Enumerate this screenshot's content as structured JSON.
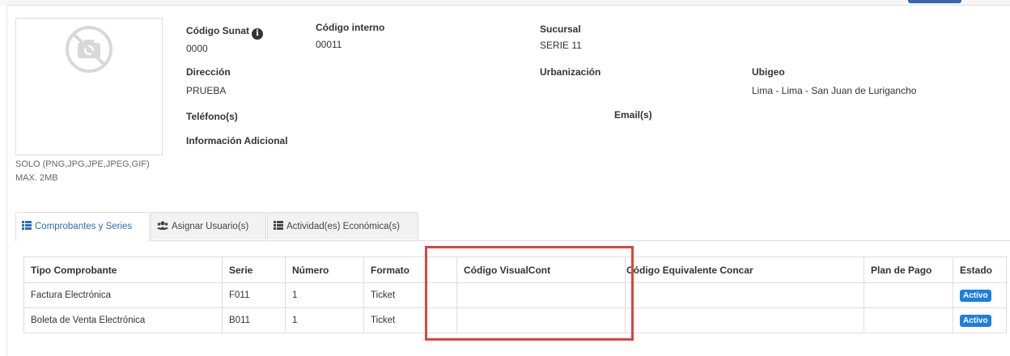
{
  "header": {
    "codigo_sunat_label": "Código Sunat",
    "codigo_sunat_value": "0000",
    "codigo_interno_label": "Código interno",
    "codigo_interno_value": "00011",
    "sucursal_label": "Sucursal",
    "sucursal_value": "SERIE 11",
    "direccion_label": "Dirección",
    "direccion_value": "PRUEBA",
    "urbanizacion_label": "Urbanización",
    "ubigeo_label": "Ubigeo",
    "ubigeo_value": "Lima - Lima - San Juan de Lurigancho",
    "telefono_label": "Teléfono(s)",
    "email_label": "Email(s)",
    "info_adicional_label": "Información Adicional"
  },
  "photo": {
    "note_line1": "SOLO (PNG,JPG,JPE,JPEG,GIF)",
    "note_line2": "MAX. 2MB"
  },
  "tabs": [
    {
      "label": "Comprobantes y Series",
      "icon": "list-icon",
      "active": true
    },
    {
      "label": "Asignar Usuario(s)",
      "icon": "users-icon",
      "active": false
    },
    {
      "label": "Actividad(es) Económica(s)",
      "icon": "list-icon",
      "active": false
    }
  ],
  "table": {
    "columns": [
      "Tipo Comprobante",
      "Serie",
      "Número",
      "Formato",
      "",
      "Código VisualCont",
      "Código Equivalente Concar",
      "Plan de Pago",
      "Estado"
    ],
    "rows": [
      {
        "tipo": "Factura Electrónica",
        "serie": "F011",
        "numero": "1",
        "formato": "Ticket",
        "blank": "",
        "visualcont": "",
        "concar": "",
        "plan": "",
        "estado": "Activo"
      },
      {
        "tipo": "Boleta de Venta Electrónica",
        "serie": "B011",
        "numero": "1",
        "formato": "Ticket",
        "blank": "",
        "visualcont": "",
        "concar": "",
        "plan": "",
        "estado": "Activo"
      }
    ]
  },
  "colors": {
    "highlight": "#d9463f",
    "badge": "#1b7fe0",
    "active_tab_text": "#2a6db5"
  }
}
